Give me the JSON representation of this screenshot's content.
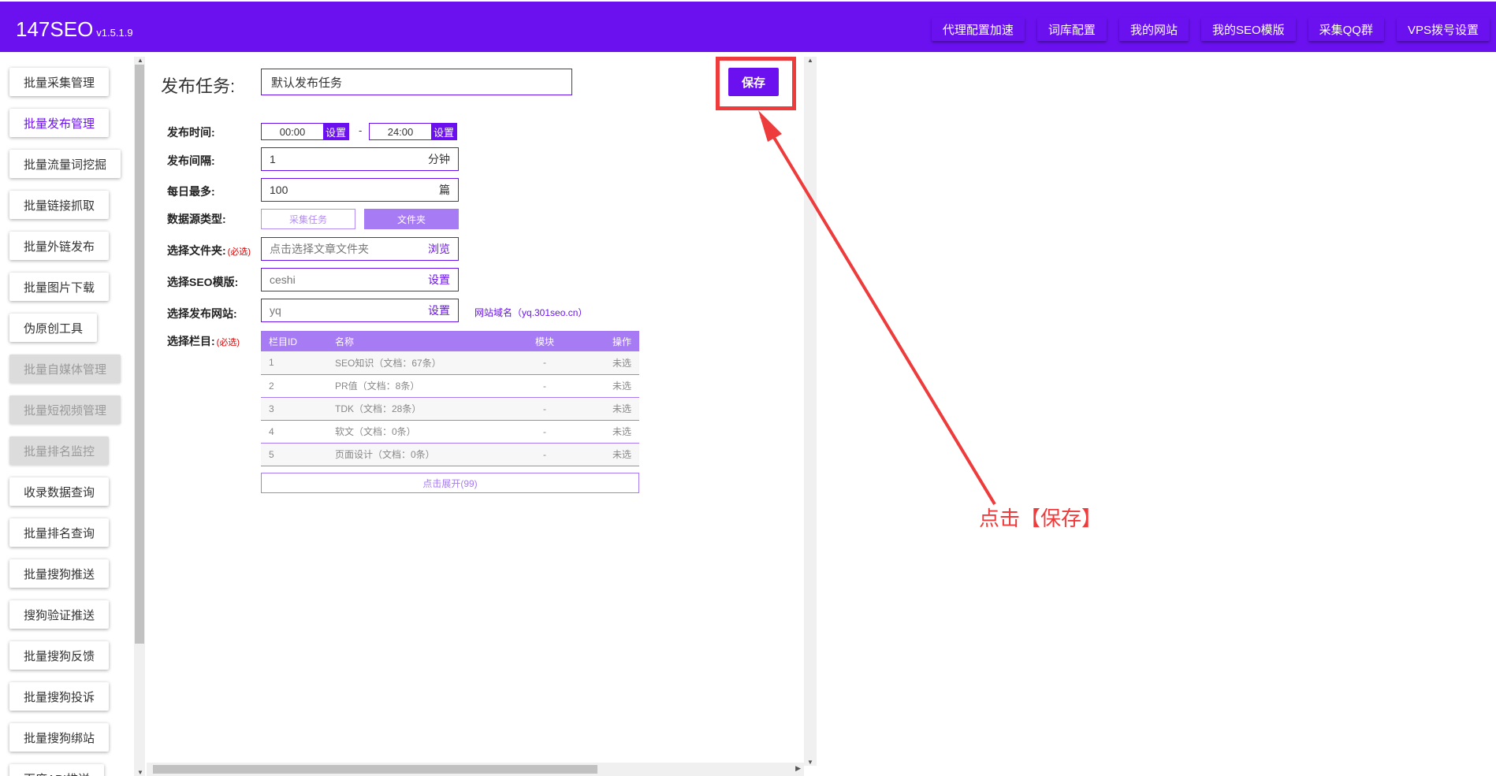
{
  "app": {
    "name": "147SEO",
    "version": "v1.5.1.9"
  },
  "topnav": [
    "代理配置加速",
    "词库配置",
    "我的网站",
    "我的SEO模版",
    "采集QQ群",
    "VPS拨号设置"
  ],
  "sidebar": [
    {
      "label": "批量采集管理",
      "state": "normal"
    },
    {
      "label": "批量发布管理",
      "state": "active"
    },
    {
      "label": "批量流量词挖掘",
      "state": "normal"
    },
    {
      "label": "批量链接抓取",
      "state": "normal"
    },
    {
      "label": "批量外链发布",
      "state": "normal"
    },
    {
      "label": "批量图片下载",
      "state": "normal"
    },
    {
      "label": "伪原创工具",
      "state": "normal"
    },
    {
      "label": "批量自媒体管理",
      "state": "disabled"
    },
    {
      "label": "批量短视频管理",
      "state": "disabled"
    },
    {
      "label": "批量排名监控",
      "state": "disabled"
    },
    {
      "label": "收录数据查询",
      "state": "normal"
    },
    {
      "label": "批量排名查询",
      "state": "normal"
    },
    {
      "label": "批量搜狗推送",
      "state": "normal"
    },
    {
      "label": "搜狗验证推送",
      "state": "normal"
    },
    {
      "label": "批量搜狗反馈",
      "state": "normal"
    },
    {
      "label": "批量搜狗投诉",
      "state": "normal"
    },
    {
      "label": "批量搜狗绑站",
      "state": "normal"
    },
    {
      "label": "百度API推送",
      "state": "normal"
    }
  ],
  "form": {
    "task_label": "发布任务:",
    "task_value": "默认发布任务",
    "save_label": "保存",
    "time_label": "发布时间:",
    "time_start": "00:00",
    "time_end": "24:00",
    "time_set": "设置",
    "time_sep": "-",
    "interval_label": "发布间隔:",
    "interval_value": "1",
    "interval_unit": "分钟",
    "daily_label": "每日最多:",
    "daily_value": "100",
    "daily_unit": "篇",
    "source_label": "数据源类型:",
    "source_options": [
      "采集任务",
      "文件夹"
    ],
    "source_selected": "文件夹",
    "folder_label": "选择文件夹:",
    "required": "(必选)",
    "folder_placeholder": "点击选择文章文件夹",
    "folder_action": "浏览",
    "tpl_label": "选择SEO模版:",
    "tpl_value": "ceshi",
    "tpl_action": "设置",
    "site_label": "选择发布网站:",
    "site_value": "yq",
    "site_action": "设置",
    "site_hint": "网站域名（yq.301seo.cn）",
    "column_label": "选择栏目:",
    "expand_label": "点击展开(99)"
  },
  "table": {
    "headers": [
      "栏目ID",
      "名称",
      "模块",
      "操作"
    ],
    "rows": [
      [
        "1",
        "SEO知识（文档：67条）",
        "-",
        "未选"
      ],
      [
        "2",
        "PR值（文档：8条）",
        "-",
        "未选"
      ],
      [
        "3",
        "TDK（文档：28条）",
        "-",
        "未选"
      ],
      [
        "4",
        "软文（文档：0条）",
        "-",
        "未选"
      ],
      [
        "5",
        "页面设计（文档：0条）",
        "-",
        "未选"
      ]
    ]
  },
  "annotation": {
    "text": "点击【保存】",
    "color": "#ee3b3b"
  },
  "colors": {
    "brand": "#6b11f0",
    "accent_light": "#a77bf3"
  }
}
